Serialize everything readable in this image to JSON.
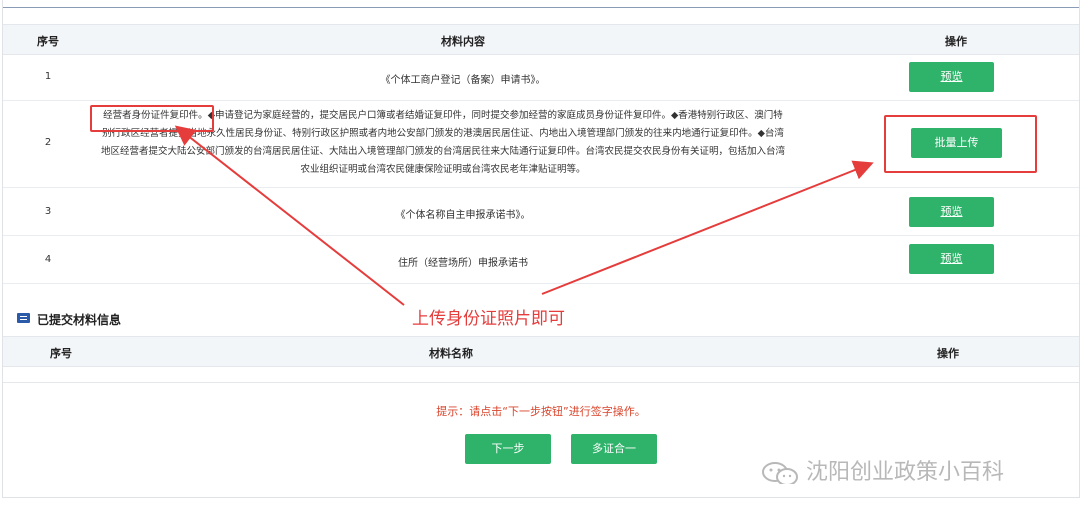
{
  "table": {
    "headers": {
      "index": "序号",
      "content": "材料内容",
      "action": "操作"
    },
    "rows": [
      {
        "index": "1",
        "content": "《个体工商户登记（备案）申请书》。",
        "button": "预览"
      },
      {
        "index": "2",
        "content_highlight": "经营者身份证件复印件。",
        "content_rest": "◆申请登记为家庭经营的，提交居民户口簿或者结婚证复印件，同时提交参加经营的家庭成员身份证件复印件。◆香港特别行政区、澳门特别行政区经营者提交当地永久性居民身份证、特别行政区护照或者内地公安部门颁发的港澳居民居住证、内地出入境管理部门颁发的往来内地通行证复印件。◆台湾地区经营者提交大陆公安部门颁发的台湾居民居住证、大陆出入境管理部门颁发的台湾居民往来大陆通行证复印件。台湾农民提交农民身份有关证明，包括加入台湾农业组织证明或台湾农民健康保险证明或台湾农民老年津贴证明等。",
        "button": "批量上传"
      },
      {
        "index": "3",
        "content": "《个体名称自主申报承诺书》。",
        "button": "预览"
      },
      {
        "index": "4",
        "content": "住所（经营场所）申报承诺书",
        "button": "预览"
      }
    ]
  },
  "submitted": {
    "title": "已提交材料信息",
    "headers": {
      "index": "序号",
      "name": "材料名称",
      "action": "操作"
    }
  },
  "hint": "提示：请点击“下一步按钮”进行签字操作。",
  "buttons": {
    "next": "下一步",
    "multi": "多证合一"
  },
  "annotation": "上传身份证照片即可",
  "watermark": "沈阳创业政策小百科",
  "colors": {
    "accent": "#2fb36a",
    "annotation": "#e53c3c",
    "hint": "#d9442b"
  }
}
